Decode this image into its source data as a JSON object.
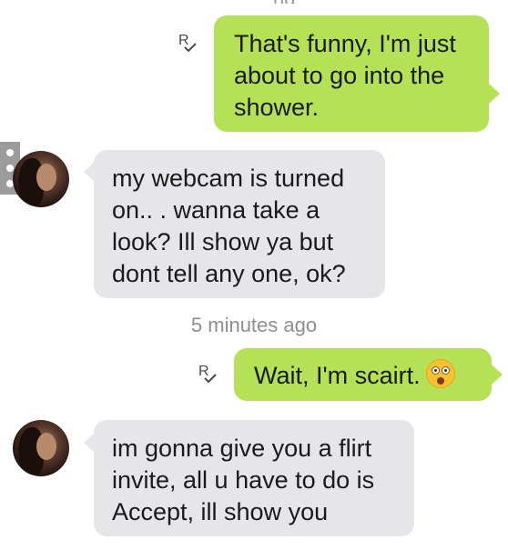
{
  "chat": {
    "messages": [
      {
        "direction": "outgoing",
        "text": "That's funny, I'm just\nabout to go into the\nshower.",
        "receipt": "R"
      },
      {
        "direction": "incoming",
        "text": "my webcam is turned\non.. . wanna take a\nlook? Ill show ya but\ndont tell any one, ok?"
      },
      {
        "direction": "outgoing",
        "text": "Wait, I'm scairt.",
        "emoji": "astonished-face-emoji",
        "receipt": "R"
      },
      {
        "direction": "incoming",
        "text": "im gonna give you a flirt\ninvite, all u have to do is\nAccept, ill show you"
      }
    ],
    "timestamp": "5 minutes ago"
  },
  "colors": {
    "outgoing_bubble": "#b5e156",
    "incoming_bubble": "#e6e6ea",
    "timestamp_text": "#8e8e93",
    "side_handle": "#9c9c9c"
  },
  "icons": {
    "read_receipt": "read-receipt-icon",
    "side_menu": "more-options-icon",
    "avatar": "contact-avatar"
  }
}
